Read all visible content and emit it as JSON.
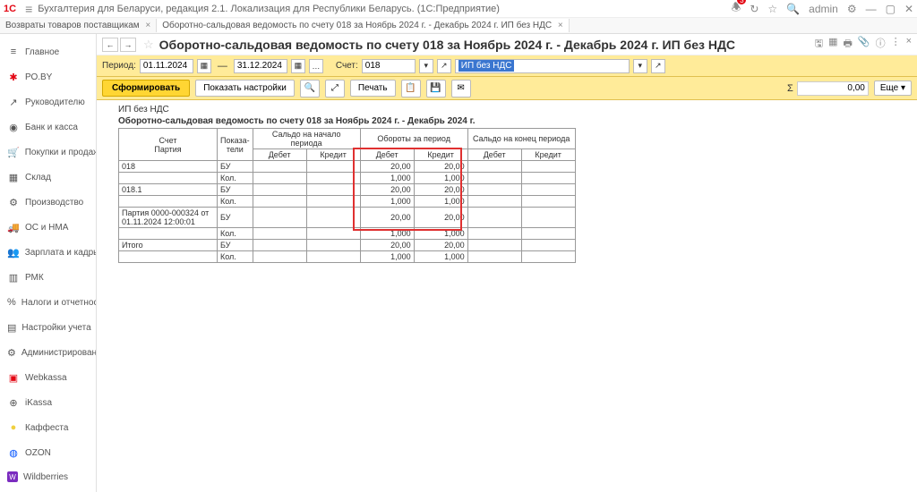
{
  "titlebar": {
    "logo": "1С",
    "title": "Бухгалтерия для Беларуси, редакция 2.1. Локализация для Республики Беларусь. (1С:Предприятие)",
    "user": "admin"
  },
  "tabs": [
    {
      "label": "Возвраты товаров поставщикам"
    },
    {
      "label": "Оборотно-сальдовая ведомость по счету 018 за Ноябрь 2024 г. - Декабрь 2024 г. ИП без НДС"
    }
  ],
  "sidebar": {
    "items": [
      {
        "label": "Главное",
        "icon": "≡"
      },
      {
        "label": "РО.BY",
        "icon": "✱",
        "color": "#e30613"
      },
      {
        "label": "Руководителю",
        "icon": "↗"
      },
      {
        "label": "Банк и касса",
        "icon": "◉"
      },
      {
        "label": "Покупки и продажи",
        "icon": "🛒"
      },
      {
        "label": "Склад",
        "icon": "▦"
      },
      {
        "label": "Производство",
        "icon": "⚙"
      },
      {
        "label": "ОС и НМА",
        "icon": "🚚"
      },
      {
        "label": "Зарплата и кадры",
        "icon": "👥"
      },
      {
        "label": "РМК",
        "icon": "▥"
      },
      {
        "label": "Налоги и отчетность",
        "icon": "%"
      },
      {
        "label": "Настройки учета",
        "icon": "▤"
      },
      {
        "label": "Администрирование",
        "icon": "⚙"
      },
      {
        "label": "Webkassa",
        "icon": "▣",
        "color": "#e30613"
      },
      {
        "label": "iKassa",
        "icon": "⊕"
      },
      {
        "label": "Каффеста",
        "icon": "●",
        "color": "#f0d040"
      },
      {
        "label": "OZON",
        "icon": "◍",
        "color": "#0051ff"
      },
      {
        "label": "Wildberries",
        "icon": "W",
        "color": "#7b2cbf"
      }
    ]
  },
  "page": {
    "title": "Оборотно-сальдовая ведомость по счету 018 за Ноябрь 2024 г. - Декабрь 2024 г. ИП без НДС"
  },
  "period": {
    "label": "Период:",
    "from": "01.11.2024",
    "to": "31.12.2024",
    "account_label": "Счет:",
    "account": "018",
    "org": "ИП без НДС"
  },
  "toolbar": {
    "generate": "Сформировать",
    "show_settings": "Показать настройки",
    "print": "Печать",
    "sum_value": "0,00",
    "more": "Еще"
  },
  "report": {
    "org": "ИП без НДС",
    "title": "Оборотно-сальдовая ведомость по счету 018 за Ноябрь 2024 г. - Декабрь 2024 г.",
    "headers": {
      "account": "Счет",
      "batch": "Партия",
      "indicators": "Показа-\nтели",
      "begin": "Сальдо на начало периода",
      "turnover": "Обороты за период",
      "end": "Сальдо на конец периода",
      "debit": "Дебет",
      "credit": "Кредит"
    },
    "rows": [
      {
        "acc": "018",
        "ind": "БУ",
        "td": "20,00",
        "tc": "20,00"
      },
      {
        "acc": "",
        "ind": "Кол.",
        "td": "1,000",
        "tc": "1,000"
      },
      {
        "acc": "018.1",
        "ind": "БУ",
        "td": "20,00",
        "tc": "20,00"
      },
      {
        "acc": "",
        "ind": "Кол.",
        "td": "1,000",
        "tc": "1,000"
      },
      {
        "acc": "Партия 0000-000324 от 01.11.2024 12:00:01",
        "ind": "БУ",
        "td": "20,00",
        "tc": "20,00"
      },
      {
        "acc": "",
        "ind": "Кол.",
        "td": "1,000",
        "tc": "1,000"
      },
      {
        "acc": "Итого",
        "ind": "БУ",
        "td": "20,00",
        "tc": "20,00"
      },
      {
        "acc": "",
        "ind": "Кол.",
        "td": "1,000",
        "tc": "1,000"
      }
    ]
  }
}
